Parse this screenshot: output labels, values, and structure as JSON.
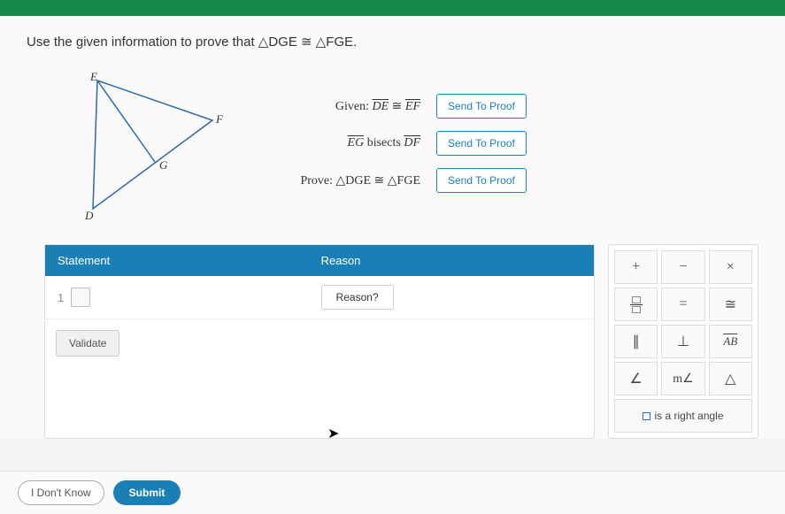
{
  "instruction": "Use the given information to prove that △DGE ≅ △FGE.",
  "diagram": {
    "labels": {
      "E": "E",
      "F": "F",
      "G": "G",
      "D": "D"
    }
  },
  "givens": [
    {
      "prefix": "Given: ",
      "math_html": "<span class='overline'>DE</span> ≅ <span class='overline'>EF</span>",
      "button": "Send To Proof"
    },
    {
      "prefix": "",
      "math_html": "<span class='overline'>EG</span> bisects <span class='overline'>DF</span>",
      "button": "Send To Proof"
    },
    {
      "prefix": "Prove: ",
      "math_html": "△DGE ≅ △FGE",
      "button": "Send To Proof"
    }
  ],
  "table": {
    "headers": {
      "statement": "Statement",
      "reason": "Reason"
    },
    "row_num": "1",
    "reason_button": "Reason?",
    "validate": "Validate"
  },
  "palette": {
    "buttons": [
      "+",
      "−",
      "×",
      "□⁄□",
      "=",
      "≅",
      "∥",
      "⊥",
      "AB",
      "∠",
      "m∠",
      "△"
    ],
    "right_angle": "is a right angle"
  },
  "bottom": {
    "idk": "I Don't Know",
    "submit": "Submit"
  }
}
